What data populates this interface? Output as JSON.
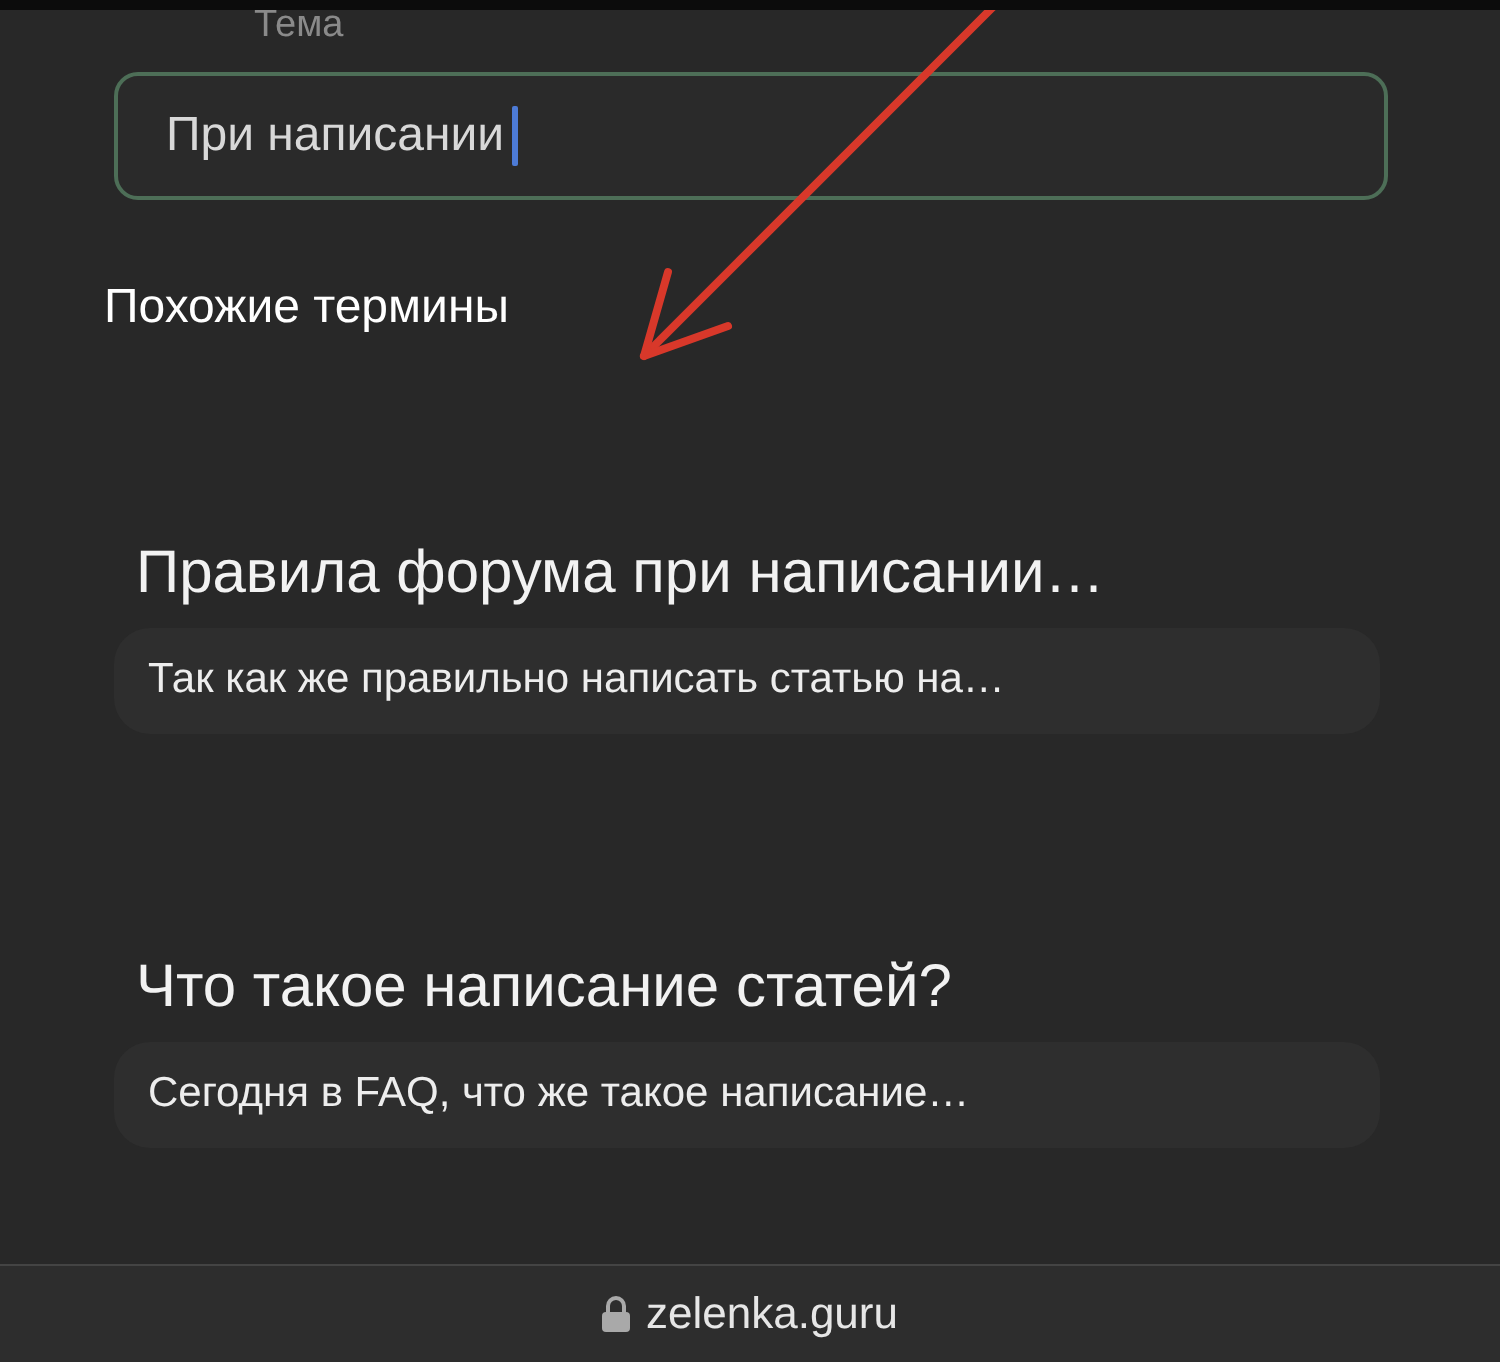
{
  "field": {
    "label": "Тема",
    "value": "При написании"
  },
  "section_title": "Похожие термины",
  "results": [
    {
      "title": "Правила форума при написании…",
      "snippet": "Так как же правильно написать статью на…"
    },
    {
      "title": "Что такое написание статей?",
      "snippet": "Сегодня в FAQ, что же такое написание…"
    }
  ],
  "address_bar": {
    "url": "zelenka.guru"
  }
}
